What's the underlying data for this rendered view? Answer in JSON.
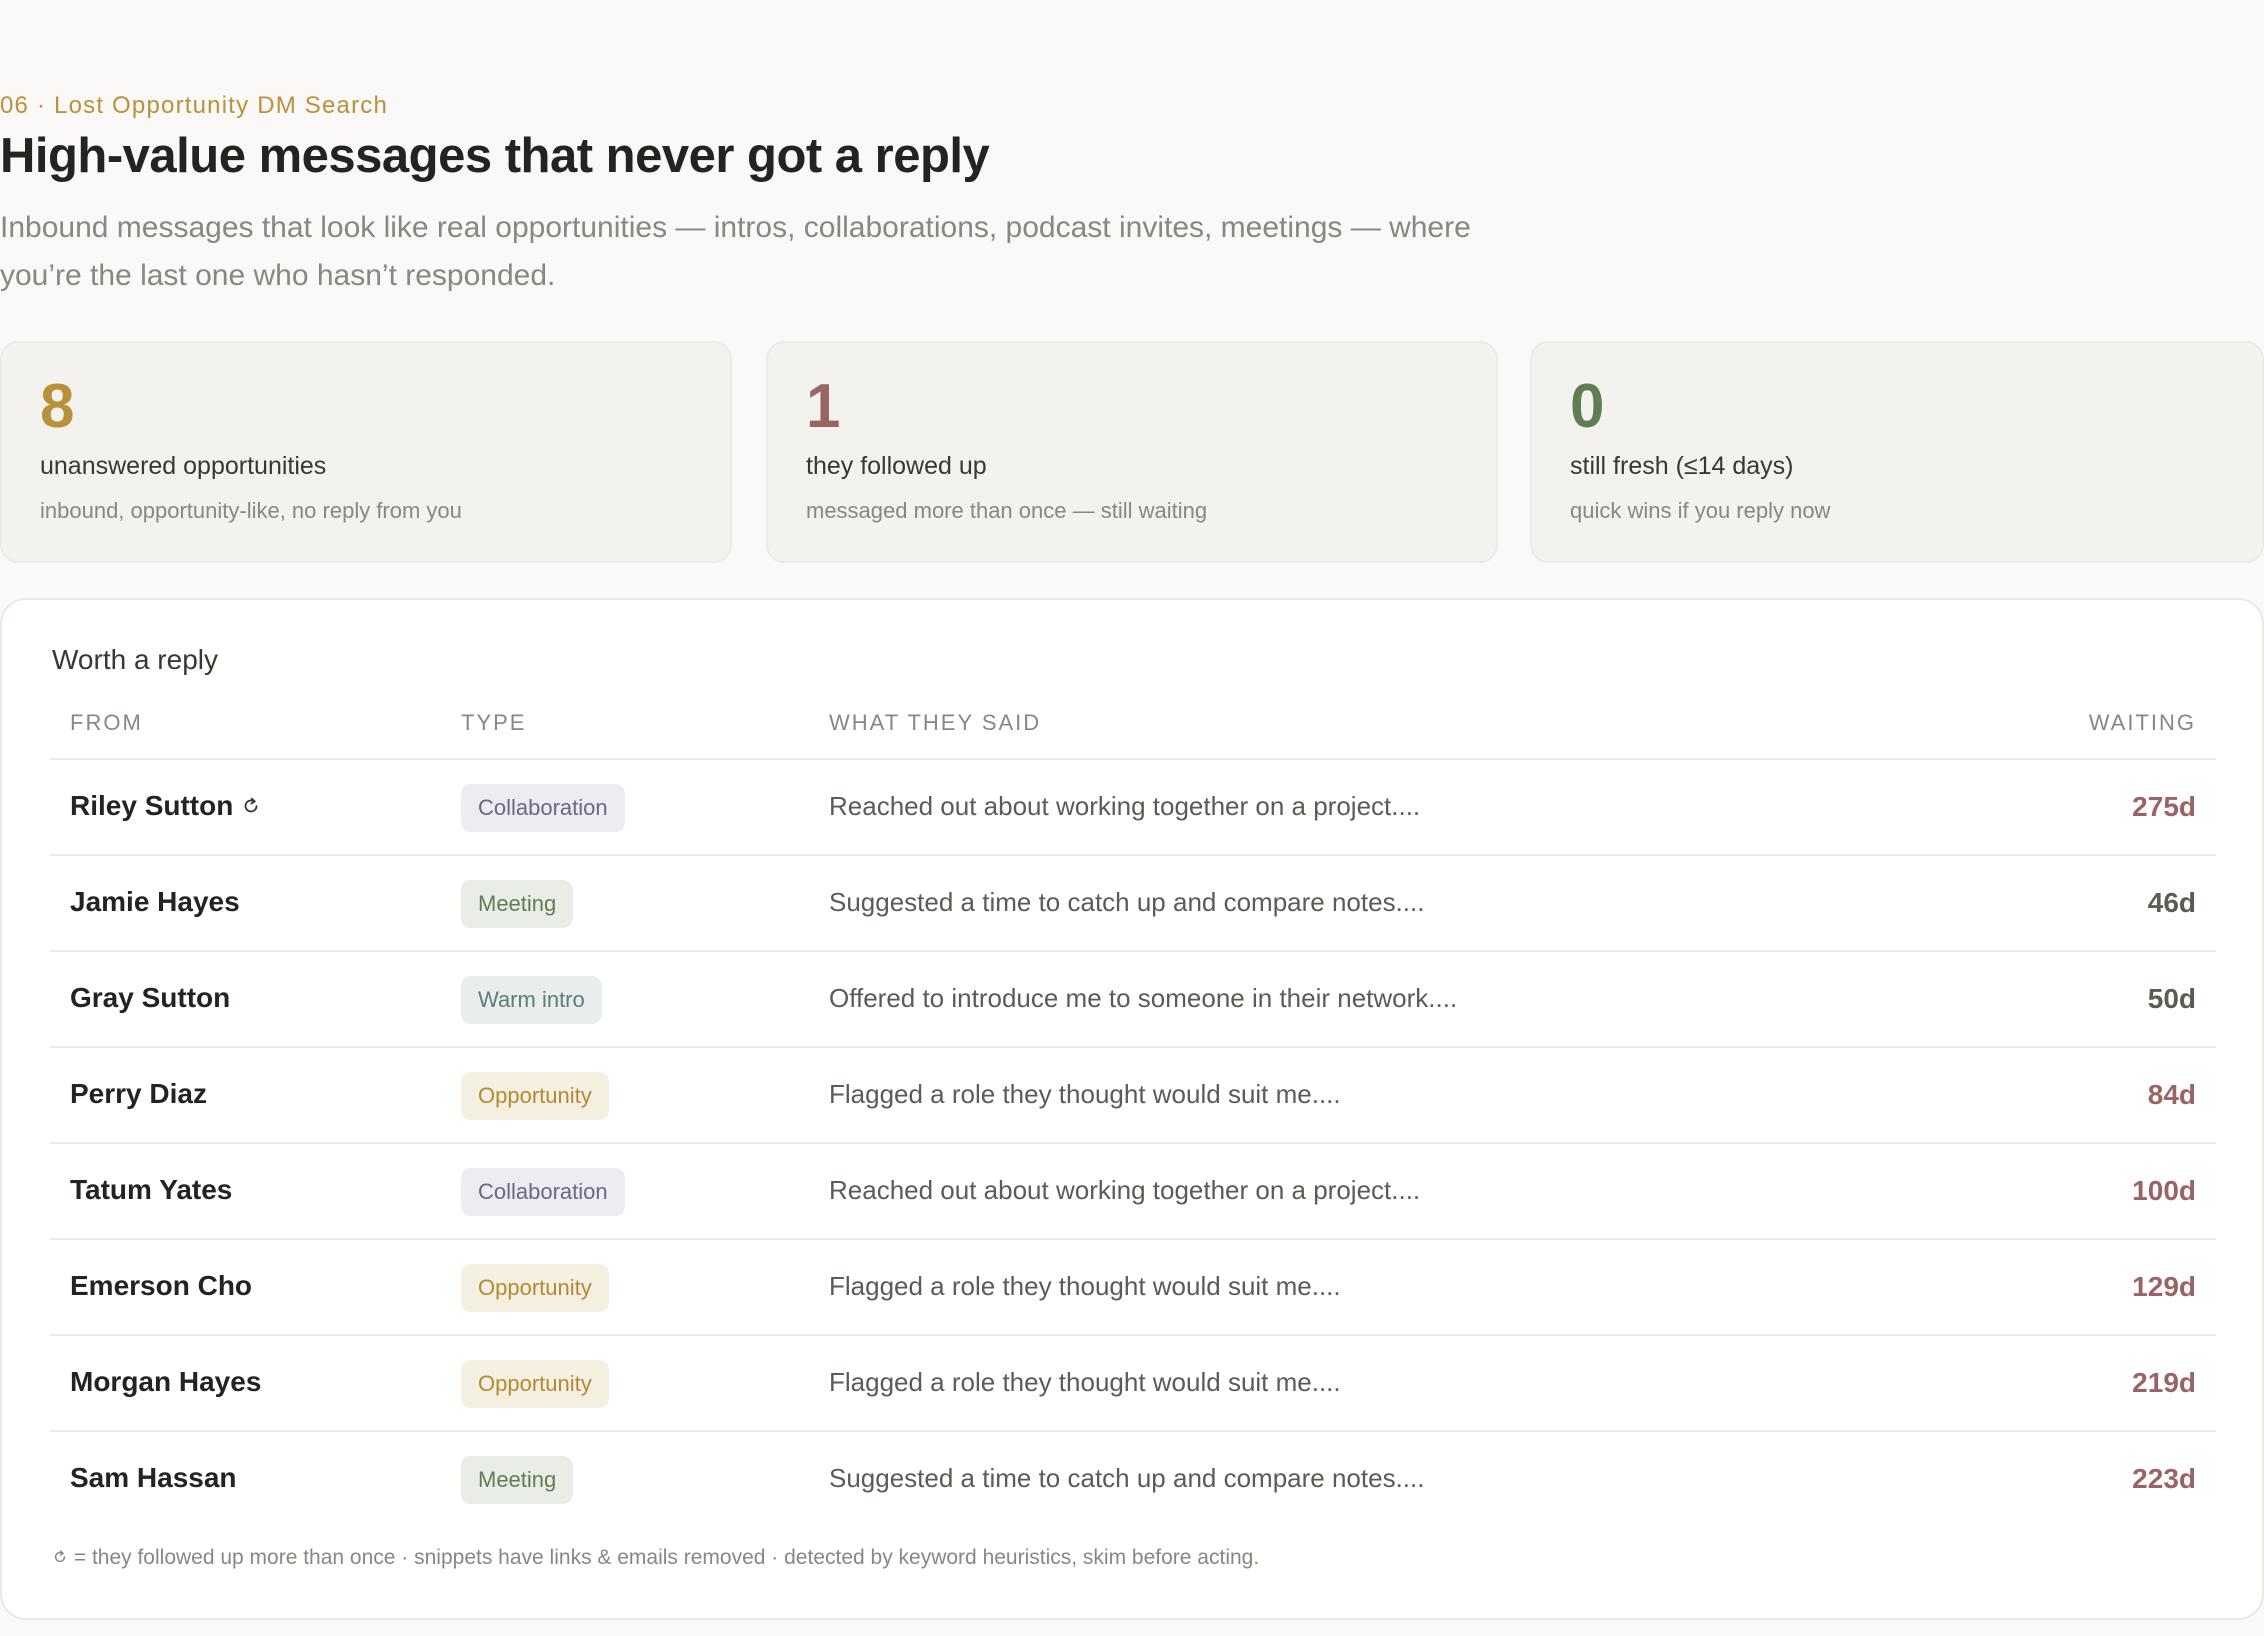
{
  "header": {
    "eyebrow": "06 · Lost Opportunity DM Search",
    "title": "High-value messages that never got a reply",
    "subtitle": "Inbound messages that look like real opportunities — intros, collaborations, podcast invites, meetings — where you’re the last one who hasn’t responded."
  },
  "stats": [
    {
      "value": "8",
      "label": "unanswered opportunities",
      "sub": "inbound, opportunity-like, no reply from you",
      "color": "#b8913a"
    },
    {
      "value": "1",
      "label": "they followed up",
      "sub": "messaged more than once — still waiting",
      "color": "#9a6464"
    },
    {
      "value": "0",
      "label": "still fresh (≤14 days)",
      "sub": "quick wins if you reply now",
      "color": "#5f7d52"
    }
  ],
  "table": {
    "heading": "Worth a reply",
    "columns": {
      "from": "FROM",
      "type": "TYPE",
      "said": "WHAT THEY SAID",
      "waiting": "WAITING"
    },
    "rows": [
      {
        "name": "Riley Sutton",
        "followed_up": true,
        "type": "Collaboration",
        "said": "Reached out about working together on a project....",
        "waiting": "275d",
        "wait_color": "#9a6464"
      },
      {
        "name": "Jamie Hayes",
        "followed_up": false,
        "type": "Meeting",
        "said": "Suggested a time to catch up and compare notes....",
        "waiting": "46d",
        "wait_color": "#5e5a54"
      },
      {
        "name": "Gray Sutton",
        "followed_up": false,
        "type": "Warm intro",
        "said": "Offered to introduce me to someone in their network....",
        "waiting": "50d",
        "wait_color": "#5e5a54"
      },
      {
        "name": "Perry Diaz",
        "followed_up": false,
        "type": "Opportunity",
        "said": "Flagged a role they thought would suit me....",
        "waiting": "84d",
        "wait_color": "#9a6464"
      },
      {
        "name": "Tatum Yates",
        "followed_up": false,
        "type": "Collaboration",
        "said": "Reached out about working together on a project....",
        "waiting": "100d",
        "wait_color": "#9a6464"
      },
      {
        "name": "Emerson Cho",
        "followed_up": false,
        "type": "Opportunity",
        "said": "Flagged a role they thought would suit me....",
        "waiting": "129d",
        "wait_color": "#9a6464"
      },
      {
        "name": "Morgan Hayes",
        "followed_up": false,
        "type": "Opportunity",
        "said": "Flagged a role they thought would suit me....",
        "waiting": "219d",
        "wait_color": "#9a6464"
      },
      {
        "name": "Sam Hassan",
        "followed_up": false,
        "type": "Meeting",
        "said": "Suggested a time to catch up and compare notes....",
        "waiting": "223d",
        "wait_color": "#9a6464"
      }
    ],
    "footnote": "= they followed up more than once · snippets have links & emails removed · detected by keyword heuristics, skim before acting."
  },
  "type_colors": {
    "Collaboration": {
      "bg": "#eeebf1",
      "fg": "#6e6584"
    },
    "Meeting": {
      "bg": "#eaede6",
      "fg": "#5f7d52"
    },
    "Warm intro": {
      "bg": "#e9eeed",
      "fg": "#5a7e7b"
    },
    "Opportunity": {
      "bg": "#f6f0e2",
      "fg": "#b08a35"
    }
  }
}
